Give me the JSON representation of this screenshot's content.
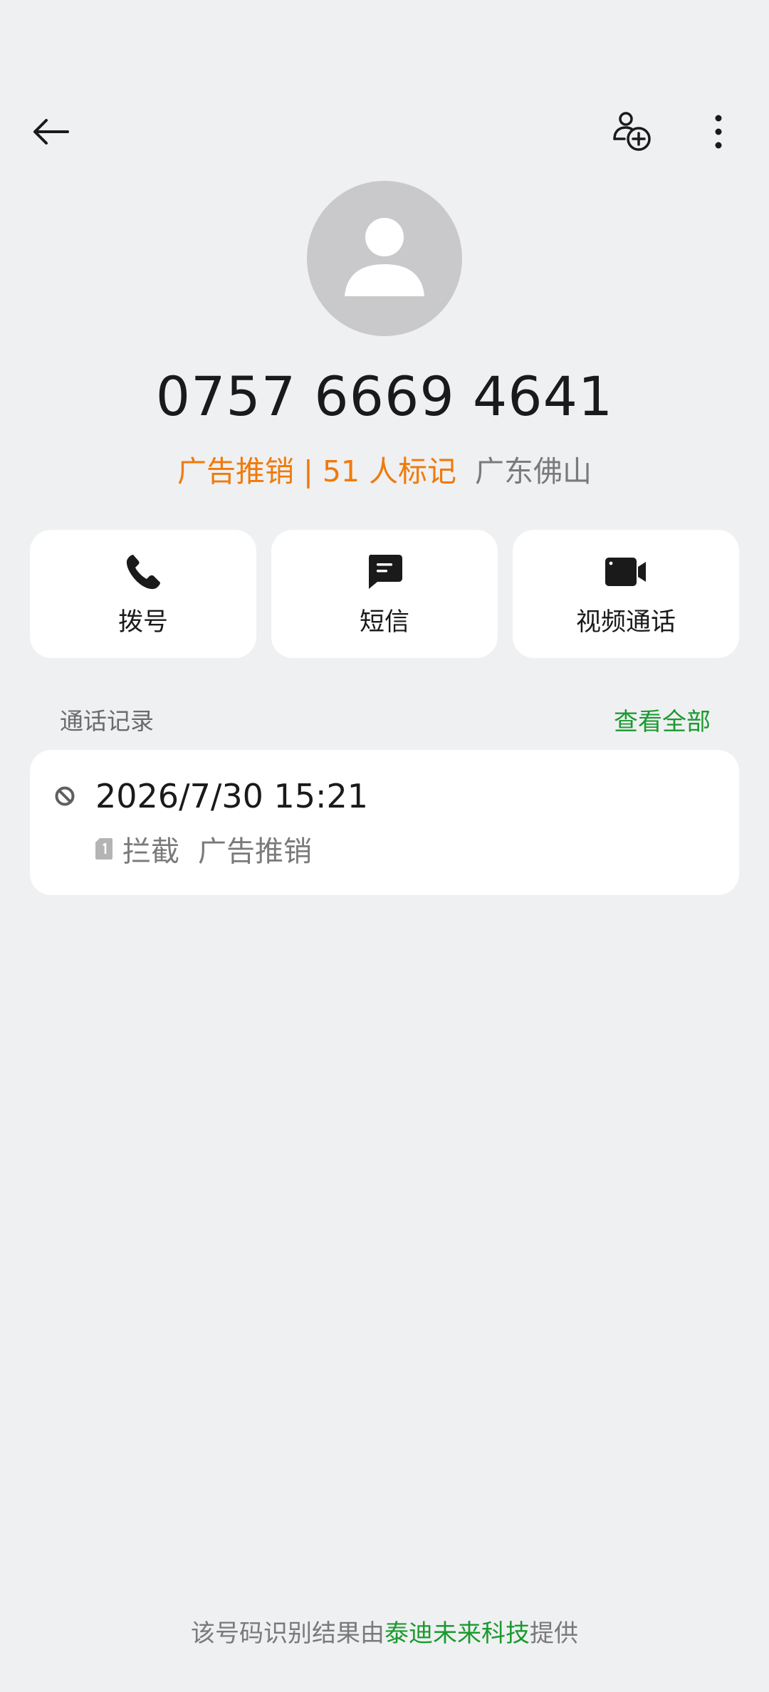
{
  "header": {
    "back_icon": "arrow-left-icon",
    "add_contact_icon": "add-contact-icon",
    "more_icon": "more-vertical-icon"
  },
  "contact": {
    "avatar_icon": "person-placeholder-icon",
    "number": "0757 6669 4641",
    "tag": "广告推销 | 51 人标记",
    "location": "广东佛山",
    "tag_color": "#f07a0a"
  },
  "actions": [
    {
      "label": "拨号",
      "icon": "phone-icon"
    },
    {
      "label": "短信",
      "icon": "message-icon"
    },
    {
      "label": "视频通话",
      "icon": "video-call-icon"
    }
  ],
  "call_log": {
    "title": "通话记录",
    "view_all": "查看全部",
    "records": [
      {
        "time": "2026/7/30 15:21",
        "status": "拦截",
        "tag": "广告推销",
        "icon": "blocked-icon",
        "sim_icon": "sim1-icon"
      }
    ]
  },
  "footer": {
    "prefix": "该号码识别结果由",
    "provider": "泰迪未来科技",
    "suffix": "提供",
    "accent_color": "#1a9a2e"
  }
}
